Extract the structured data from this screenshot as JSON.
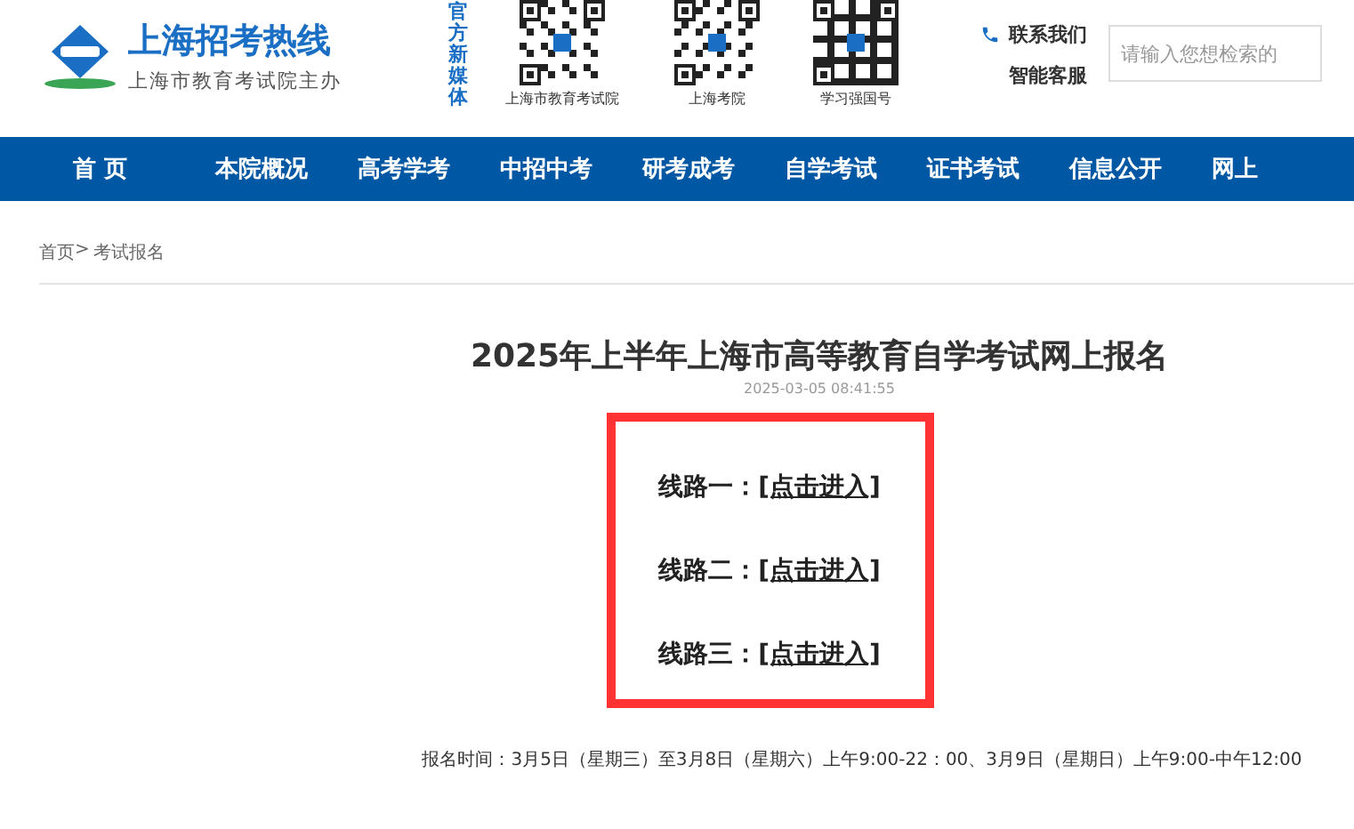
{
  "header": {
    "site_title": "上海招考热线",
    "site_subtitle": "上海市教育考试院主办",
    "media_label": "官方新媒体",
    "qr_codes": [
      {
        "label": "上海市教育考试院"
      },
      {
        "label": "上海考院"
      },
      {
        "label": "学习强国号"
      }
    ],
    "contact": "联系我们",
    "service": "智能客服",
    "search": {
      "placeholder": "请输入您想检索的"
    }
  },
  "nav": [
    {
      "label": "首 页"
    },
    {
      "label": "本院概况"
    },
    {
      "label": "高考学考"
    },
    {
      "label": "中招中考"
    },
    {
      "label": "研考成考"
    },
    {
      "label": "自学考试"
    },
    {
      "label": "证书考试"
    },
    {
      "label": "信息公开"
    },
    {
      "label": "网上"
    }
  ],
  "breadcrumb": {
    "separator": ">",
    "items": [
      {
        "label": "首页"
      },
      {
        "label": "考试报名"
      }
    ]
  },
  "article": {
    "title": "2025年上半年上海市高等教育自学考试网上报名",
    "date": "2025-03-05 08:41:55",
    "routes": [
      {
        "label": "线路一：",
        "link": "[点击进入]"
      },
      {
        "label": "线路二：",
        "link": "[点击进入]"
      },
      {
        "label": "线路三：",
        "link": "[点击进入]"
      }
    ],
    "note": "报名时间：3月5日（星期三）至3月8日（星期六）上午9:00-22：00、3月9日（星期日）上午9:00-中午12:00"
  }
}
